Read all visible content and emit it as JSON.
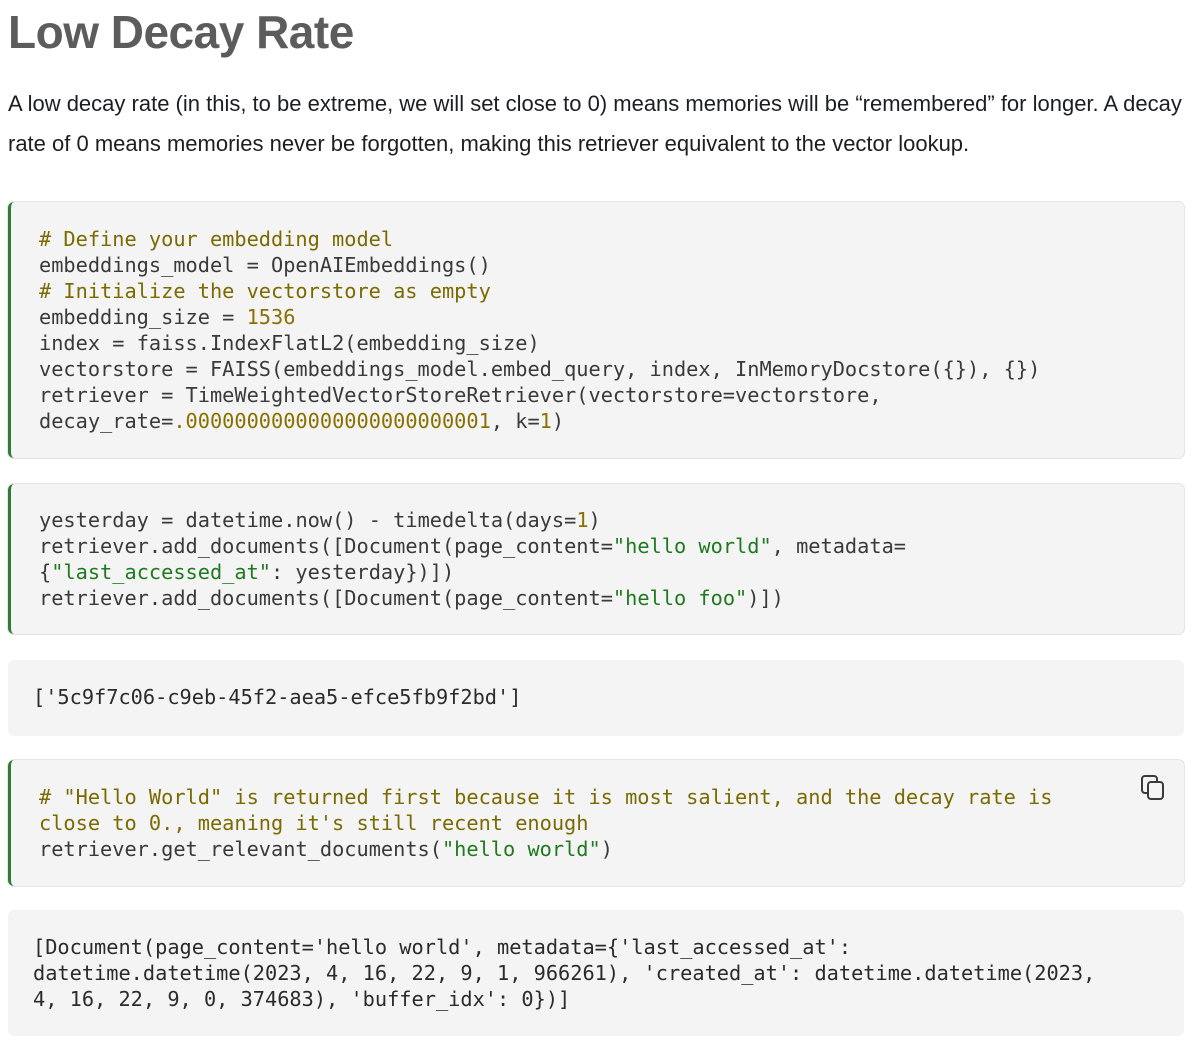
{
  "heading": "Low Decay Rate",
  "intro": "A low decay rate (in this, to be extreme, we will set close to 0) means memories will be “remembered” for longer. A decay rate of 0 means memories never be forgotten, making this retriever equivalent to the vector lookup.",
  "cell1": {
    "comment1": "# Define your embedding model",
    "l2a": "embeddings_model ",
    "l2b": "=",
    "l2c": " OpenAIEmbeddings()",
    "comment2": "# Initialize the vectorstore as empty",
    "l4a": "embedding_size ",
    "l4b": "=",
    "l4c": " ",
    "l4num": "1536",
    "l5a": "index ",
    "l5b": "=",
    "l5c": " faiss",
    "l5d": ".",
    "l5e": "IndexFlatL2(embedding_size)",
    "l6a": "vectorstore ",
    "l6b": "=",
    "l6c": " FAISS(embeddings_model",
    "l6d": ".",
    "l6e": "embed_query, index, InMemoryDocstore({}), {})",
    "l7a": "retriever ",
    "l7b": "=",
    "l7c": " TimeWeightedVectorStoreRetriever(vectorstore",
    "l7d": "=",
    "l7e": "vectorstore,",
    "l8a": "decay_rate",
    "l8b": "=",
    "l8num": ".0000000000000000000000001",
    "l8c": ", k",
    "l8d": "=",
    "l8num2": "1",
    "l8e": ")"
  },
  "cell2": {
    "l1a": "yesterday ",
    "l1b": "=",
    "l1c": " datetime",
    "l1d": ".",
    "l1e": "now() ",
    "l1f": "-",
    "l1g": " timedelta(days",
    "l1h": "=",
    "l1num": "1",
    "l1i": ")",
    "l2a": "retriever",
    "l2b": ".",
    "l2c": "add_documents([Document(page_content",
    "l2d": "=",
    "l2str": "\"hello world\"",
    "l2e": ", metadata",
    "l2f": "=",
    "l3a": "{",
    "l3str": "\"last_accessed_at\"",
    "l3b": ": yesterday})])",
    "l4a": "retriever",
    "l4b": ".",
    "l4c": "add_documents([Document(page_content",
    "l4d": "=",
    "l4str": "\"hello foo\"",
    "l4e": ")])"
  },
  "output1": "['5c9f7c06-c9eb-45f2-aea5-efce5fb9f2bd']",
  "cell3": {
    "comment1": "# \"Hello World\" is returned first because it is most salient, and the decay rate is",
    "comment2": "close to 0., meaning it's still recent enough",
    "l3a": "retriever",
    "l3b": ".",
    "l3c": "get_relevant_documents(",
    "l3str": "\"hello world\"",
    "l3d": ")",
    "copy_icon": "copy-icon"
  },
  "output2": {
    "line1": "[Document(page_content='hello world', metadata={'last_accessed_at':",
    "line2": "datetime.datetime(2023, 4, 16, 22, 9, 1, 966261), 'created_at': datetime.datetime(2023,",
    "line3": "4, 16, 22, 9, 0, 374683), 'buffer_idx': 0})]"
  },
  "colors": {
    "accent": "#2e7d32",
    "block_bg": "#f4f4f4",
    "comment": "#7a6a00",
    "string": "#1f7a1f"
  }
}
